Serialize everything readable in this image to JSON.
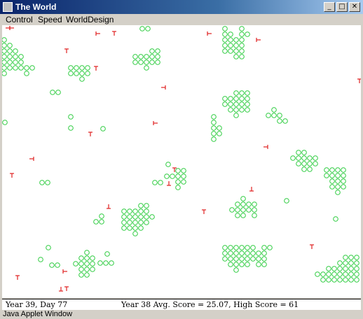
{
  "window": {
    "title": "The World"
  },
  "controls": {
    "minimize": "_",
    "maximize": "□",
    "close": "✕"
  },
  "menu": [
    {
      "label": "Control"
    },
    {
      "label": "Speed"
    },
    {
      "label": "WorldDesign"
    }
  ],
  "status": {
    "left": "Year 39, Day 77",
    "right": "Year 38 Avg. Score = 25.07, High Score = 61"
  },
  "footer": {
    "text": "Java Applet Window"
  },
  "colors": {
    "creature": "#2ecc40",
    "predator": "#e02020",
    "titlebar": "#0a246a"
  },
  "icons": {
    "creature": "circle",
    "predator": "t-glyph"
  }
}
